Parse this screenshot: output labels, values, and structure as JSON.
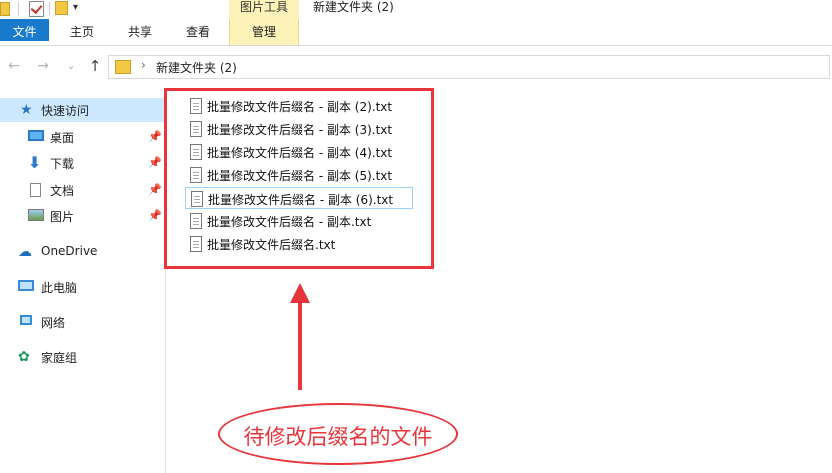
{
  "titlebar": {
    "context_tab_label": "图片工具",
    "window_title": "新建文件夹 (2)",
    "quick_access_dropdown": "▾"
  },
  "ribbon": {
    "tabs": [
      {
        "label": "文件"
      },
      {
        "label": "主页"
      },
      {
        "label": "共享"
      },
      {
        "label": "查看"
      },
      {
        "label": "管理"
      }
    ]
  },
  "nav": {
    "back": "←",
    "forward": "→",
    "recent": "⌄",
    "up": "↑",
    "address_chevron": "›",
    "address_path": "新建文件夹 (2)"
  },
  "sidebar": {
    "items": [
      {
        "label": "快速访问",
        "icon": "star-icon",
        "pinned": false
      },
      {
        "label": "桌面",
        "icon": "desktop-icon",
        "pinned": true
      },
      {
        "label": "下载",
        "icon": "download-icon",
        "pinned": true
      },
      {
        "label": "文档",
        "icon": "document-icon",
        "pinned": true
      },
      {
        "label": "图片",
        "icon": "pictures-icon",
        "pinned": true
      },
      {
        "label": "OneDrive",
        "icon": "cloud-icon",
        "pinned": false
      },
      {
        "label": "此电脑",
        "icon": "computer-icon",
        "pinned": false
      },
      {
        "label": "网络",
        "icon": "network-icon",
        "pinned": false
      },
      {
        "label": "家庭组",
        "icon": "homegroup-icon",
        "pinned": false
      }
    ],
    "pin_glyph": "📌"
  },
  "files": [
    {
      "name": "批量修改文件后缀名 - 副本 (2).txt"
    },
    {
      "name": "批量修改文件后缀名 - 副本 (3).txt"
    },
    {
      "name": "批量修改文件后缀名 - 副本 (4).txt"
    },
    {
      "name": "批量修改文件后缀名 - 副本 (5).txt"
    },
    {
      "name": "批量修改文件后缀名 - 副本 (6).txt"
    },
    {
      "name": "批量修改文件后缀名 - 副本.txt"
    },
    {
      "name": "批量修改文件后缀名.txt"
    }
  ],
  "annotation": {
    "callout_text": "待修改后缀名的文件",
    "color": "#e8353b"
  },
  "colors": {
    "file_tab": "#1979ca",
    "context_tab": "#fdf2b8",
    "selection": "#cce8ff"
  }
}
